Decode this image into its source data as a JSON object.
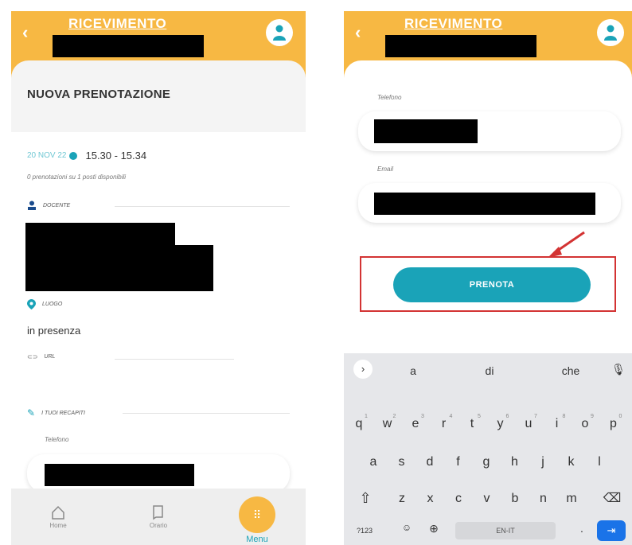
{
  "left_screen": {
    "header": {
      "title": "RICEVIMENTO"
    },
    "section_title": "NUOVA PRENOTAZIONE",
    "date": "20 NOV 22",
    "time": "15.30 - 15.34",
    "availability": "0 prenotazioni su 1 posti disponibili",
    "docente_label": "DOCENTE",
    "luogo_label": "LUOGO",
    "luogo_value": "in presenza",
    "link_label": "URL",
    "recapiti_label": "I TUOI RECAPITI",
    "telefono_label": "Telefono",
    "tabs": [
      {
        "label": "Home"
      },
      {
        "label": "Orario"
      },
      {
        "label": "Menu"
      }
    ]
  },
  "right_screen": {
    "header": {
      "title": "RICEVIMENTO"
    },
    "telefono_label": "Telefono",
    "email_label": "Email",
    "prenota_label": "PRENOTA",
    "keyboard": {
      "suggestions": [
        "a",
        "di",
        "che"
      ],
      "row1": [
        "q",
        "w",
        "e",
        "r",
        "t",
        "y",
        "u",
        "i",
        "o",
        "p"
      ],
      "row1_nums": [
        "1",
        "2",
        "3",
        "4",
        "5",
        "6",
        "7",
        "8",
        "9",
        "0"
      ],
      "row2": [
        "a",
        "s",
        "d",
        "f",
        "g",
        "h",
        "j",
        "k",
        "l"
      ],
      "row3": [
        "z",
        "x",
        "c",
        "v",
        "b",
        "n",
        "m"
      ],
      "num_key": "?123",
      "space_label": "EN-IT",
      "period": "."
    }
  },
  "colors": {
    "accent": "#f7b843",
    "teal": "#1aa3b8",
    "highlight": "#d33333"
  }
}
